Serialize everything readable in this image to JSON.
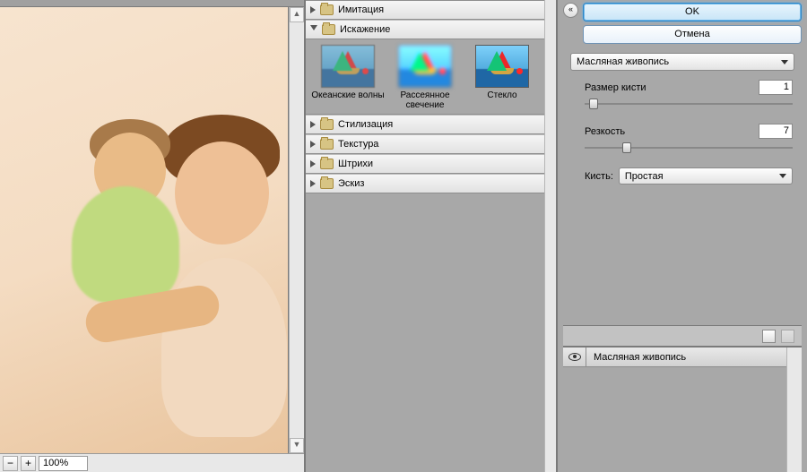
{
  "preview": {
    "zoom": "100%"
  },
  "tree": {
    "categories": [
      {
        "id": "imitation",
        "label": "Имитация",
        "open": false
      },
      {
        "id": "distortion",
        "label": "Искажение",
        "open": true
      },
      {
        "id": "stylize",
        "label": "Стилизация",
        "open": false
      },
      {
        "id": "texture",
        "label": "Текстура",
        "open": false
      },
      {
        "id": "strokes",
        "label": "Штрихи",
        "open": false
      },
      {
        "id": "sketch",
        "label": "Эскиз",
        "open": false
      }
    ],
    "distortion_items": [
      {
        "id": "ocean-ripple",
        "label": "Океанские волны"
      },
      {
        "id": "diffuse-glow",
        "label": "Рассеянное свечение"
      },
      {
        "id": "glass",
        "label": "Стекло"
      }
    ]
  },
  "buttons": {
    "ok": "OK",
    "cancel": "Отмена"
  },
  "filter_name": "Масляная живопись",
  "params": {
    "brush_size": {
      "label": "Размер кисти",
      "value": "1",
      "pos_pct": 2
    },
    "sharpness": {
      "label": "Резкость",
      "value": "7",
      "pos_pct": 18
    },
    "brush_combo": {
      "label": "Кисть:",
      "value": "Простая"
    }
  },
  "layers": [
    {
      "name": "Масляная живопись",
      "visible": true
    }
  ]
}
